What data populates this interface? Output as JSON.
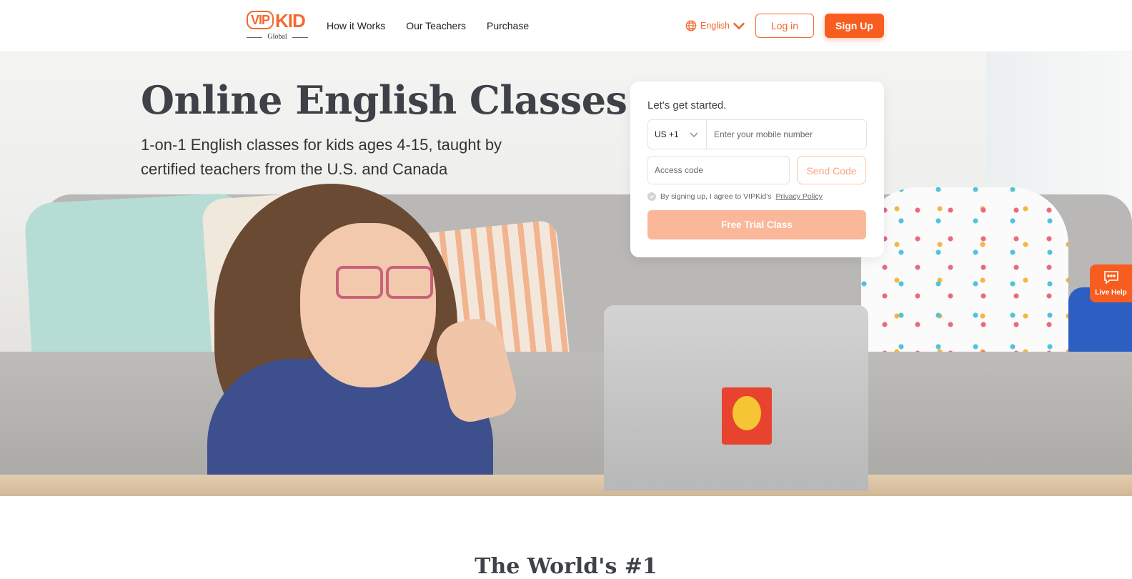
{
  "header": {
    "logo_text": "VIPKID",
    "logo_sub": "Global",
    "nav": [
      "How it Works",
      "Our Teachers",
      "Purchase"
    ],
    "language": "English",
    "login_label": "Log in",
    "signup_label": "Sign Up",
    "icons": {
      "language": "globe-icon",
      "dropdown": "chevron-down-icon"
    }
  },
  "hero": {
    "title": "Online English Classes",
    "subtitle": "1-on-1 English classes for kids ages 4-15, taught by certified teachers from the U.S. and Canada"
  },
  "signup_form": {
    "title": "Let's get started.",
    "country_code": "US +1",
    "phone_placeholder": "Enter your mobile number",
    "code_placeholder": "Access code",
    "send_code_label": "Send Code",
    "agree_text": "By signing up, I agree to VIPKid's",
    "privacy_link": "Privacy Policy",
    "submit_label": "Free Trial Class"
  },
  "live_help": {
    "label": "Live Help",
    "icon": "chat-icon"
  },
  "next_section": {
    "title": "The World's #1"
  },
  "colors": {
    "brand": "#f75d1e",
    "brand_light": "#fbb79a",
    "heading": "#3e4248"
  }
}
